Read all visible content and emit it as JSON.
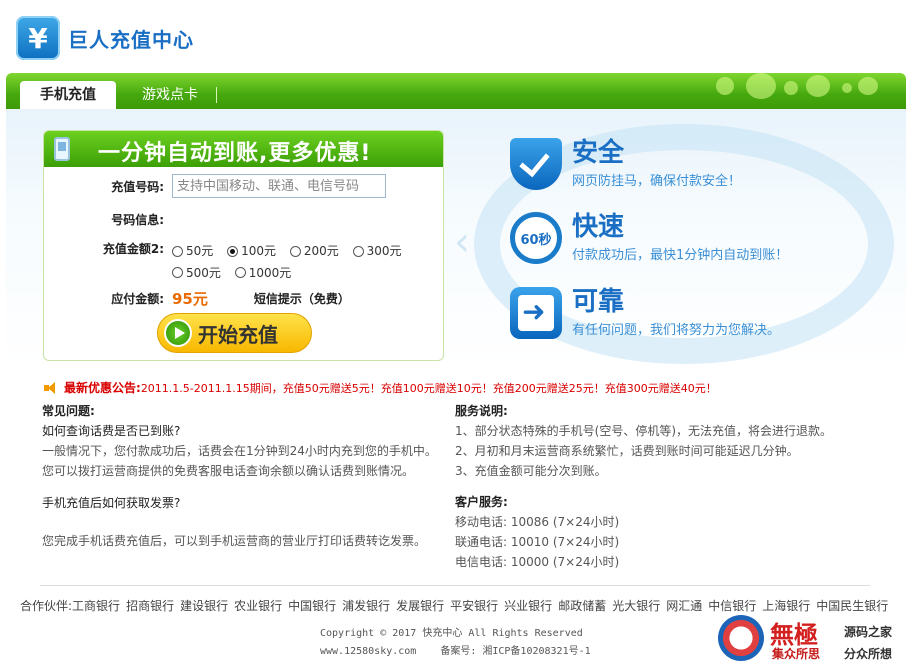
{
  "header": {
    "logo_symbol": "¥",
    "brand": "巨人充值中心"
  },
  "nav": {
    "tabs": [
      {
        "label": "手机充值",
        "active": true
      },
      {
        "label": "游戏点卡",
        "active": false
      }
    ]
  },
  "form": {
    "title": "一分钟自动到账,更多优惠!",
    "phone_label": "充值号码:",
    "phone_placeholder": "支持中国移动、联通、电信号码",
    "info_label": "号码信息:",
    "amount_label": "充值金额2:",
    "amount_options": [
      {
        "label": "50元",
        "selected": false
      },
      {
        "label": "100元",
        "selected": true
      },
      {
        "label": "200元",
        "selected": false
      },
      {
        "label": "300元",
        "selected": false
      },
      {
        "label": "500元",
        "selected": false
      },
      {
        "label": "1000元",
        "selected": false
      }
    ],
    "pay_label": "应付金额:",
    "pay_value": "95元",
    "sms_text": "短信提示（免费）",
    "start_button": "开始充值"
  },
  "features": [
    {
      "title": "安全",
      "desc": "网页防挂马，确保付款安全！",
      "icon": "shield-check-icon"
    },
    {
      "title": "快速",
      "desc": "付款成功后，最快1分钟内自动到账！",
      "icon": "clock-60-icon",
      "icon_text": "60秒"
    },
    {
      "title": "可靠",
      "desc": "有任何问题，我们将努力为您解决。",
      "icon": "arrow-right-icon"
    }
  ],
  "notice": {
    "title": "最新优惠公告:",
    "text": "2011.1.5-2011.1.15期间，充值50元赠送5元！充值100元赠送10元！充值200元赠送25元！充值300元赠送40元！"
  },
  "faq": {
    "heading": "常见问题:",
    "q1": "如何查询话费是否已到账?",
    "a1_line1": "一般情况下，您付款成功后，话费会在1分钟到24小时内充到您的手机中。",
    "a1_line2": "您可以拨打运营商提供的免费客服电话查询余额以确认话费到账情况。",
    "q2": "手机充值后如何获取发票?",
    "a2": "您完成手机话费充值后，可以到手机运营商的营业厅打印话费转讫发票。"
  },
  "service": {
    "heading": "服务说明:",
    "items": [
      "1、部分状态特殊的手机号(空号、停机等)，无法充值，将会进行退款。",
      "2、月初和月末运营商系统繁忙，话费到账时间可能延迟几分钟。",
      "3、充值金额可能分次到账。"
    ]
  },
  "support": {
    "heading": "客户服务:",
    "lines": [
      "移动电话: 10086 (7×24小时)",
      "联通电话: 10010 (7×24小时)",
      "电信电话: 10000 (7×24小时)"
    ]
  },
  "partners": {
    "label": "合作伙伴:",
    "banks": [
      "工商银行",
      "招商银行",
      "建设银行",
      "农业银行",
      "中国银行",
      "浦发银行",
      "发展银行",
      "平安银行",
      "兴业银行",
      "邮政储蓄",
      "光大银行",
      "网汇通",
      "中信银行",
      "上海银行",
      "中国民生银行"
    ]
  },
  "footer": {
    "copyright": "Copyright © 2017 快充中心 All Rights Reserved",
    "site": "www.12580sky.com",
    "icp": "备案号: 湘ICP备10208321号-1"
  },
  "watermark": {
    "main": "無極",
    "sub": "集众所思",
    "right1": "源码之家",
    "right2": "分众所想"
  }
}
